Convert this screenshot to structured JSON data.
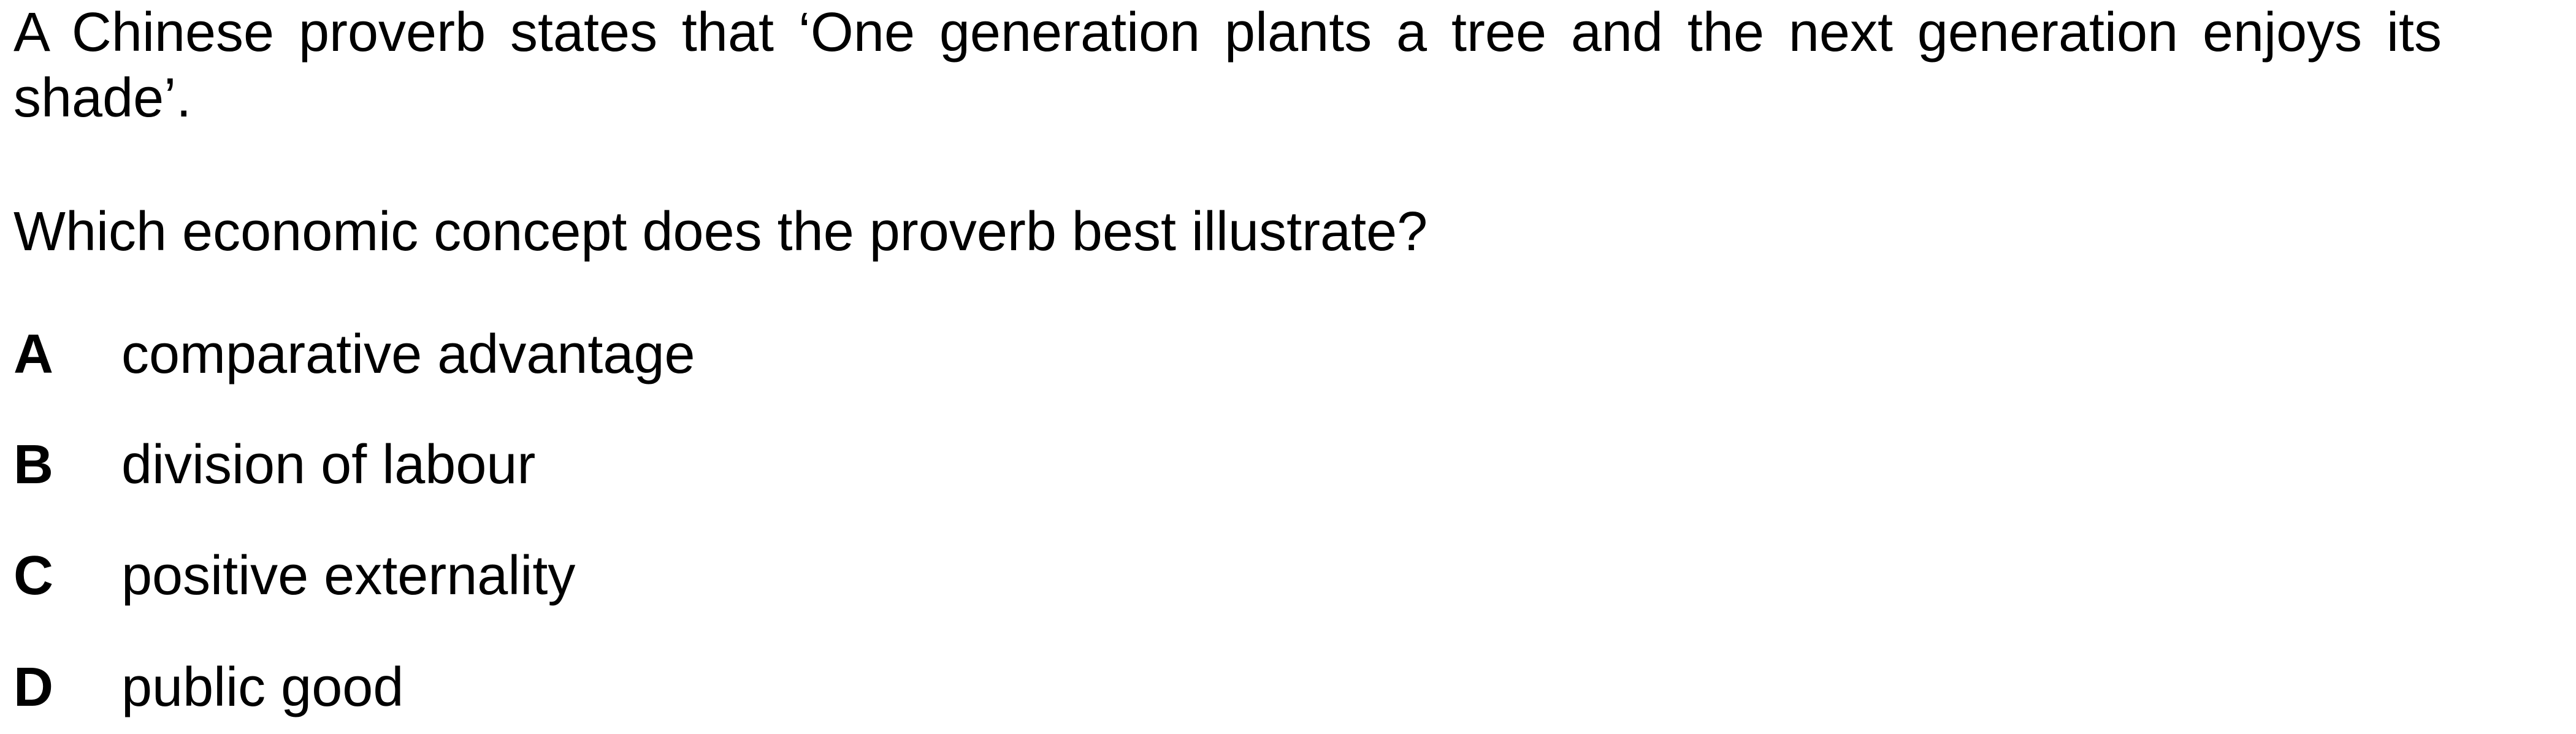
{
  "question": {
    "stem": "A Chinese proverb states that ‘One generation plants a tree and the next generation enjoys its shade’.",
    "prompt": "Which economic concept does the proverb best illustrate?",
    "options": [
      {
        "letter": "A",
        "text": "comparative advantage"
      },
      {
        "letter": "B",
        "text": "division of labour"
      },
      {
        "letter": "C",
        "text": "positive externality"
      },
      {
        "letter": "D",
        "text": "public good"
      }
    ]
  }
}
